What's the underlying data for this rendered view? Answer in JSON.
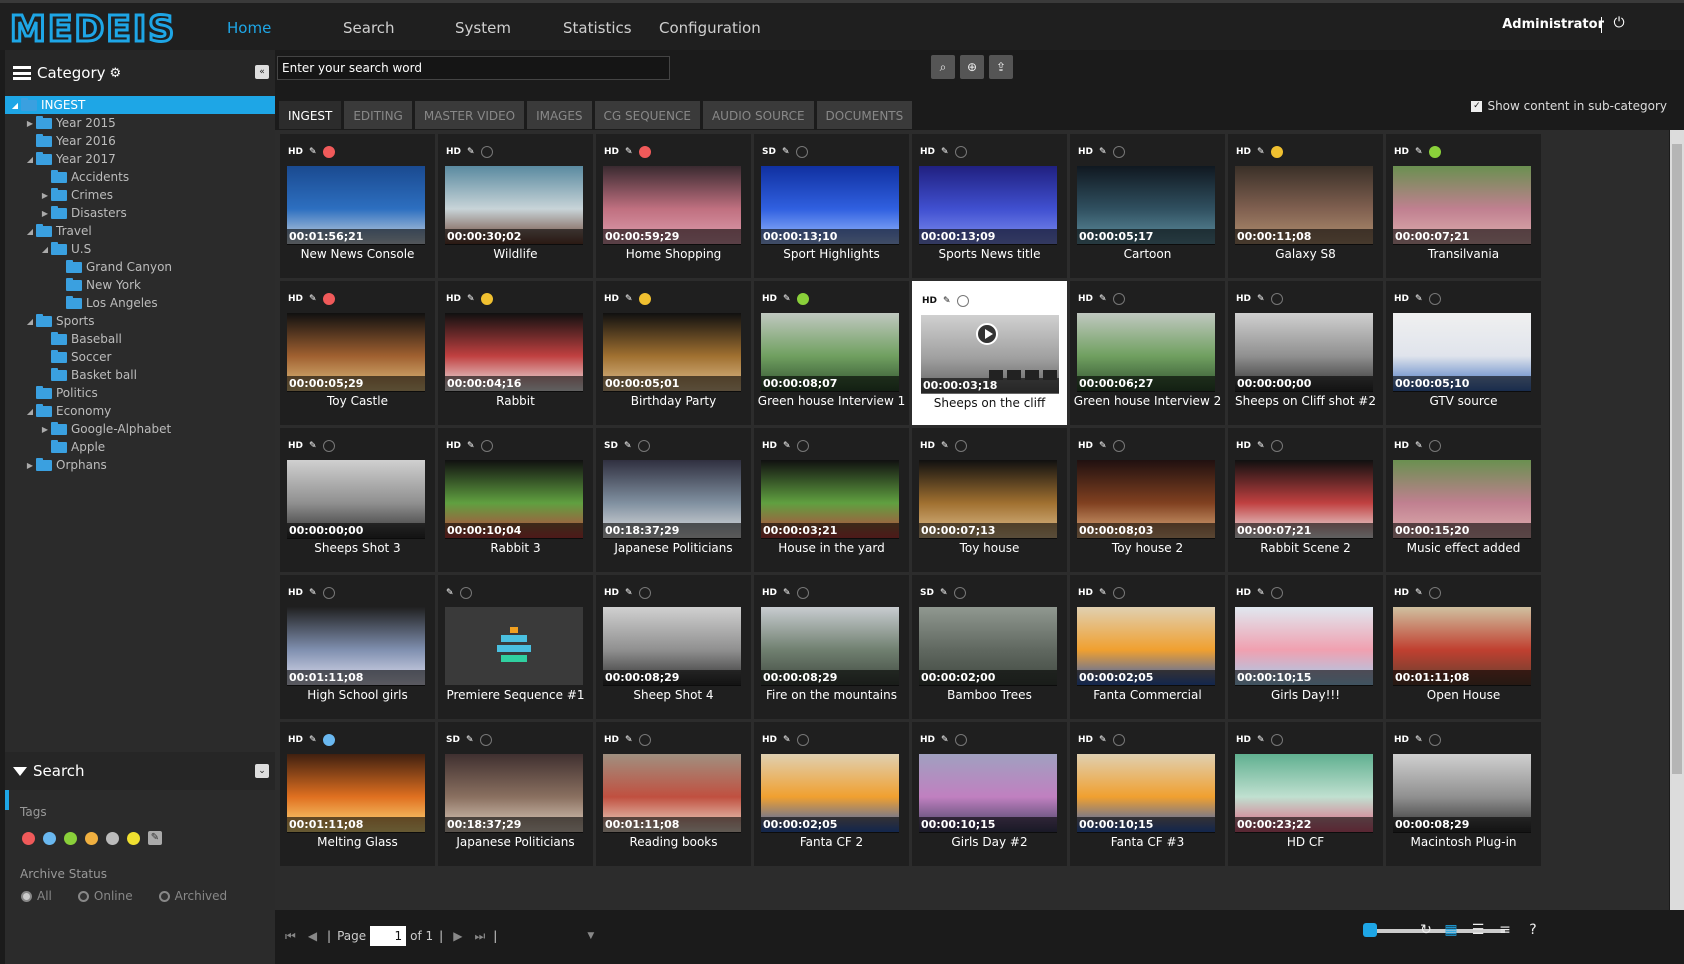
{
  "app": {
    "logo_text": "MEDEIS",
    "accent": "#1ea6e6"
  },
  "nav": [
    "Home",
    "Search",
    "System",
    "Statistics",
    "Configuration"
  ],
  "user": {
    "name": "Administrator"
  },
  "category": {
    "title": "Category",
    "tree": [
      {
        "label": "INGEST",
        "level": 0,
        "arrow": "down",
        "selected": true
      },
      {
        "label": "Year 2015",
        "level": 1,
        "arrow": "right"
      },
      {
        "label": "Year 2016",
        "level": 1,
        "arrow": ""
      },
      {
        "label": "Year 2017",
        "level": 1,
        "arrow": "down"
      },
      {
        "label": "Accidents",
        "level": 2,
        "arrow": ""
      },
      {
        "label": "Crimes",
        "level": 2,
        "arrow": "right"
      },
      {
        "label": "Disasters",
        "level": 2,
        "arrow": "right"
      },
      {
        "label": "Travel",
        "level": 1,
        "arrow": "down"
      },
      {
        "label": "U.S",
        "level": 2,
        "arrow": "down"
      },
      {
        "label": "Grand Canyon",
        "level": 3,
        "arrow": ""
      },
      {
        "label": "New York",
        "level": 3,
        "arrow": ""
      },
      {
        "label": "Los Angeles",
        "level": 3,
        "arrow": ""
      },
      {
        "label": "Sports",
        "level": 1,
        "arrow": "down"
      },
      {
        "label": "Baseball",
        "level": 2,
        "arrow": ""
      },
      {
        "label": "Soccer",
        "level": 2,
        "arrow": ""
      },
      {
        "label": "Basket ball",
        "level": 2,
        "arrow": ""
      },
      {
        "label": "Politics",
        "level": 1,
        "arrow": ""
      },
      {
        "label": "Economy",
        "level": 1,
        "arrow": "down"
      },
      {
        "label": "Google-Alphabet",
        "level": 2,
        "arrow": "right"
      },
      {
        "label": "Apple",
        "level": 2,
        "arrow": ""
      },
      {
        "label": "Orphans",
        "level": 1,
        "arrow": "right"
      }
    ]
  },
  "search_panel": {
    "title": "Search",
    "tags_label": "Tags",
    "tag_colors": [
      "#f05a5a",
      "#6ab8f0",
      "#8ad03a",
      "#f0b040",
      "#bbbbbb",
      "#f0e030"
    ],
    "archive_label": "Archive Status",
    "archive_options": [
      "All",
      "Online",
      "Archived"
    ]
  },
  "search": {
    "placeholder": "Enter your search word"
  },
  "tabs": [
    "INGEST",
    "EDITING",
    "MASTER VIDEO",
    "IMAGES",
    "CG SEQUENCE",
    "AUDIO SOURCE",
    "DOCUMENTS"
  ],
  "subcategory_label": "Show content in sub-category",
  "items": [
    {
      "title": "New News Console",
      "tc": "00:01:56;21",
      "quality": "HD",
      "tag": "#f05a5a",
      "thumb": [
        "#1a4a90",
        "#2d6fc0",
        "#cfd8e0"
      ]
    },
    {
      "title": "Wildlife",
      "tc": "00:00:30;02",
      "quality": "HD",
      "tag": "",
      "thumb": [
        "#5a8aa0",
        "#c8d4d8",
        "#6a4030"
      ]
    },
    {
      "title": "Home Shopping",
      "tc": "00:00:59;29",
      "quality": "HD",
      "tag": "#f05a5a",
      "thumb": [
        "#3a2a30",
        "#c07080",
        "#e0a0b0"
      ]
    },
    {
      "title": "Sport Highlights",
      "tc": "00:00:13;10",
      "quality": "SD",
      "tag": "",
      "thumb": [
        "#1030a0",
        "#3060e0",
        "#a0c0ff"
      ]
    },
    {
      "title": "Sports News title",
      "tc": "00:00:13;09",
      "quality": "HD",
      "tag": "",
      "thumb": [
        "#202080",
        "#4050d0",
        "#8090f0"
      ]
    },
    {
      "title": "Cartoon",
      "tc": "00:00:05;17",
      "quality": "HD",
      "tag": "",
      "thumb": [
        "#101820",
        "#305060",
        "#6090a0"
      ]
    },
    {
      "title": "Galaxy S8",
      "tc": "00:00:11;08",
      "quality": "HD",
      "tag": "#f0c030",
      "thumb": [
        "#3a3028",
        "#806050",
        "#b09070"
      ]
    },
    {
      "title": "Transilvania",
      "tc": "00:00:07;21",
      "quality": "HD",
      "tag": "#8ad03a",
      "thumb": [
        "#6a9050",
        "#c08090",
        "#e0b0b0"
      ]
    },
    {
      "title": "Toy Castle",
      "tc": "00:00:05;29",
      "quality": "HD",
      "tag": "#f05a5a",
      "thumb": [
        "#101010",
        "#a06030",
        "#e0c080"
      ]
    },
    {
      "title": "Rabbit",
      "tc": "00:00:04;16",
      "quality": "HD",
      "tag": "#f0c030",
      "thumb": [
        "#101010",
        "#c04040",
        "#f0f0f0"
      ]
    },
    {
      "title": "Birthday Party",
      "tc": "00:00:05;01",
      "quality": "HD",
      "tag": "#f0c030",
      "thumb": [
        "#101010",
        "#a07030",
        "#e0c090"
      ]
    },
    {
      "title": "Green house Interview 1",
      "tc": "00:00:08;07",
      "quality": "HD",
      "tag": "#8ad03a",
      "thumb": [
        "#c0c8c0",
        "#70a060",
        "#305030"
      ]
    },
    {
      "title": "Sheeps on the cliff",
      "tc": "00:00:03;18",
      "quality": "HD",
      "tag": "",
      "thumb": [
        "#d0d0d0",
        "#a0a0a0",
        "#606060"
      ],
      "selected": true
    },
    {
      "title": "Green house Interview 2",
      "tc": "00:00:06;27",
      "quality": "HD",
      "tag": "",
      "thumb": [
        "#c0c8c0",
        "#70a060",
        "#305030"
      ]
    },
    {
      "title": "Sheeps on Cliff shot #2",
      "tc": "00:00:00;00",
      "quality": "HD",
      "tag": "",
      "thumb": [
        "#d0d0d0",
        "#909090",
        "#303030"
      ]
    },
    {
      "title": "GTV source",
      "tc": "00:00:05;10",
      "quality": "HD",
      "tag": "",
      "thumb": [
        "#f0f0f0",
        "#e0e4ec",
        "#4070c0"
      ]
    },
    {
      "title": "Sheeps Shot 3",
      "tc": "00:00:00;00",
      "quality": "HD",
      "tag": "",
      "thumb": [
        "#d0d0d0",
        "#909090",
        "#303030"
      ]
    },
    {
      "title": "Rabbit 3",
      "tc": "00:00:10;04",
      "quality": "HD",
      "tag": "",
      "thumb": [
        "#101010",
        "#60a040",
        "#c04040"
      ]
    },
    {
      "title": "Japanese Politicians",
      "tc": "00:18:37;29",
      "quality": "SD",
      "tag": "",
      "thumb": [
        "#303040",
        "#8090a0",
        "#e0e0e0"
      ]
    },
    {
      "title": "House in the yard",
      "tc": "00:00:03;21",
      "quality": "HD",
      "tag": "",
      "thumb": [
        "#101010",
        "#60a040",
        "#c04040"
      ]
    },
    {
      "title": "Toy house",
      "tc": "00:00:07;13",
      "quality": "HD",
      "tag": "",
      "thumb": [
        "#101010",
        "#a07030",
        "#e0c090"
      ]
    },
    {
      "title": "Toy house 2",
      "tc": "00:00:08;03",
      "quality": "HD",
      "tag": "",
      "thumb": [
        "#201010",
        "#804020",
        "#e0b080"
      ]
    },
    {
      "title": "Rabbit Scene 2",
      "tc": "00:00:07;21",
      "quality": "HD",
      "tag": "",
      "thumb": [
        "#101010",
        "#c04040",
        "#f0f0f0"
      ]
    },
    {
      "title": "Music effect added",
      "tc": "00:00:15;20",
      "quality": "HD",
      "tag": "",
      "thumb": [
        "#6a9050",
        "#c08090",
        "#e0b0b0"
      ]
    },
    {
      "title": "High School girls",
      "tc": "00:01:11;08",
      "quality": "HD",
      "tag": "",
      "thumb": [
        "#202020",
        "#8090b0",
        "#e0e0f0"
      ]
    },
    {
      "title": "Premiere Sequence #1",
      "tc": "",
      "quality": "",
      "tag": "",
      "thumb": [
        "#3a3a3a",
        "#3a3a3a",
        "#3a3a3a"
      ],
      "sequence": true
    },
    {
      "title": "Sheep Shot 4",
      "tc": "00:00:08;29",
      "quality": "HD",
      "tag": "",
      "thumb": [
        "#d0d0d0",
        "#909090",
        "#303030"
      ]
    },
    {
      "title": "Fire on the mountains",
      "tc": "00:00:08;29",
      "quality": "HD",
      "tag": "",
      "thumb": [
        "#c8ccd0",
        "#708070",
        "#404840"
      ]
    },
    {
      "title": "Bamboo Trees",
      "tc": "00:00:02;00",
      "quality": "SD",
      "tag": "",
      "thumb": [
        "#909890",
        "#606860",
        "#404840"
      ]
    },
    {
      "title": "Fanta Commercial",
      "tc": "00:00:02;05",
      "quality": "HD",
      "tag": "",
      "thumb": [
        "#e0d0b0",
        "#f0a030",
        "#3060c0"
      ]
    },
    {
      "title": "Girls Day!!!",
      "tc": "00:00:10;15",
      "quality": "HD",
      "tag": "",
      "thumb": [
        "#e0e8f0",
        "#f0a0b0",
        "#a0d0f0"
      ]
    },
    {
      "title": "Open House",
      "tc": "00:01:11;08",
      "quality": "HD",
      "tag": "",
      "thumb": [
        "#d0c0a0",
        "#c04030",
        "#604030"
      ]
    },
    {
      "title": "Melting Glass",
      "tc": "00:01:11;08",
      "quality": "HD",
      "tag": "#6ab8f0",
      "thumb": [
        "#402010",
        "#e07020",
        "#ffe080"
      ]
    },
    {
      "title": "Japanese Politicians",
      "tc": "00:18:37;29",
      "quality": "SD",
      "tag": "",
      "thumb": [
        "#403030",
        "#8a7060",
        "#e0d0c0"
      ]
    },
    {
      "title": "Reading books",
      "tc": "00:01:11;08",
      "quality": "HD",
      "tag": "",
      "thumb": [
        "#a09080",
        "#c05040",
        "#f0e0d0"
      ]
    },
    {
      "title": "Fanta CF 2",
      "tc": "00:00:02;05",
      "quality": "HD",
      "tag": "",
      "thumb": [
        "#e0d0b0",
        "#f0a030",
        "#3060c0"
      ]
    },
    {
      "title": "Girls Day #2",
      "tc": "00:00:10;15",
      "quality": "HD",
      "tag": "",
      "thumb": [
        "#a0a0c0",
        "#c080c0",
        "#404060"
      ]
    },
    {
      "title": "Fanta CF #3",
      "tc": "00:00:10;15",
      "quality": "HD",
      "tag": "",
      "thumb": [
        "#e0d0b0",
        "#f0a030",
        "#3060c0"
      ]
    },
    {
      "title": "HD CF",
      "tc": "00:00:23;22",
      "quality": "HD",
      "tag": "",
      "thumb": [
        "#60b090",
        "#c0e0d0",
        "#e06080"
      ]
    },
    {
      "title": "Macintosh Plug-in",
      "tc": "00:00:08;29",
      "quality": "HD",
      "tag": "",
      "thumb": [
        "#d0d0d0",
        "#909090",
        "#303030"
      ]
    }
  ],
  "pager": {
    "page_label": "Page",
    "page": "1",
    "of_label": "of 1"
  }
}
